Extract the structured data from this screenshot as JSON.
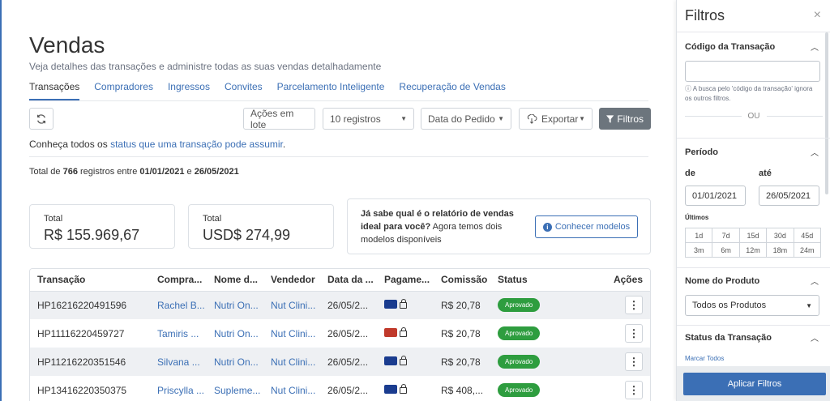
{
  "page": {
    "title": "Vendas",
    "subtitle": "Veja detalhes das transações e administre todas as suas vendas detalhadamente"
  },
  "tabs": [
    {
      "label": "Transações",
      "active": true
    },
    {
      "label": "Compradores",
      "active": false
    },
    {
      "label": "Ingressos",
      "active": false
    },
    {
      "label": "Convites",
      "active": false
    },
    {
      "label": "Parcelamento Inteligente",
      "active": false
    },
    {
      "label": "Recuperação de Vendas",
      "active": false
    }
  ],
  "toolbar": {
    "refresh_icon": "refresh-icon",
    "batch_label": "Ações em lote",
    "records_label": "10 registros",
    "date_label": "Data do Pedido",
    "export_label": "Exportar",
    "filters_label": "Filtros"
  },
  "status_note": {
    "prefix": "Conheça todos os",
    "link": "status que uma transação pode assumir",
    "suffix": "."
  },
  "totals": {
    "prefix": "Total de",
    "count": "766",
    "middle": "registros entre",
    "start": "01/01/2021",
    "and": "e",
    "end": "26/05/2021"
  },
  "cards": [
    {
      "label": "Total",
      "value": "R$ 155.969,67"
    },
    {
      "label": "Total",
      "value": "USD$ 274,99"
    }
  ],
  "info_card": {
    "bold": "Já sabe qual é o relatório de vendas ideal para você?",
    "rest": " Agora temos dois modelos disponíveis",
    "button": "Conhecer modelos"
  },
  "table": {
    "headers": [
      "Transação",
      "Compra...",
      "Nome d...",
      "Vendedor",
      "Data da ...",
      "Pagame...",
      "Comissão",
      "Status",
      "Ações"
    ],
    "rows": [
      {
        "id": "HP16216220491596",
        "buyer": "Rachel B...",
        "product": "Nutri On...",
        "seller": "Nut Clini...",
        "date": "26/05/2...",
        "card_color": "#1a3c8f",
        "commission": "R$ 20,78",
        "status": "Aprovado"
      },
      {
        "id": "HP11116220459727",
        "buyer": "Tamiris ...",
        "product": "Nutri On...",
        "seller": "Nut Clini...",
        "date": "26/05/2...",
        "card_color": "#c0392b",
        "commission": "R$ 20,78",
        "status": "Aprovado"
      },
      {
        "id": "HP11216220351546",
        "buyer": "Silvana ...",
        "product": "Nutri On...",
        "seller": "Nut Clini...",
        "date": "26/05/2...",
        "card_color": "#1a3c8f",
        "commission": "R$ 20,78",
        "status": "Aprovado"
      },
      {
        "id": "HP13416220350375",
        "buyer": "Priscylla ...",
        "product": "Supleme...",
        "seller": "Nut Clini...",
        "date": "26/05/2...",
        "card_color": "#1a3c8f",
        "commission": "R$ 408,...",
        "status": "Aprovado"
      }
    ]
  },
  "panel": {
    "title": "Filtros",
    "close": "×",
    "code_section": "Código da Transação",
    "code_note": "A busca pelo 'código da transação' ignora os outros filtros.",
    "ou": "OU",
    "period_section": "Período",
    "from_label": "de",
    "to_label": "até",
    "from_value": "01/01/2021",
    "to_value": "26/05/2021",
    "last_label": "Últimos",
    "ranges": [
      "1d",
      "7d",
      "15d",
      "30d",
      "45d",
      "3m",
      "6m",
      "12m",
      "18m",
      "24m"
    ],
    "product_section": "Nome do Produto",
    "product_value": "Todos os Produtos",
    "status_section": "Status da Transação",
    "mark_all": "Marcar Todos",
    "apply": "Aplicar Filtros"
  },
  "colors": {
    "accent": "#3b6fb5",
    "approved": "#2e9d3f",
    "filters_button": "#6c757d"
  }
}
